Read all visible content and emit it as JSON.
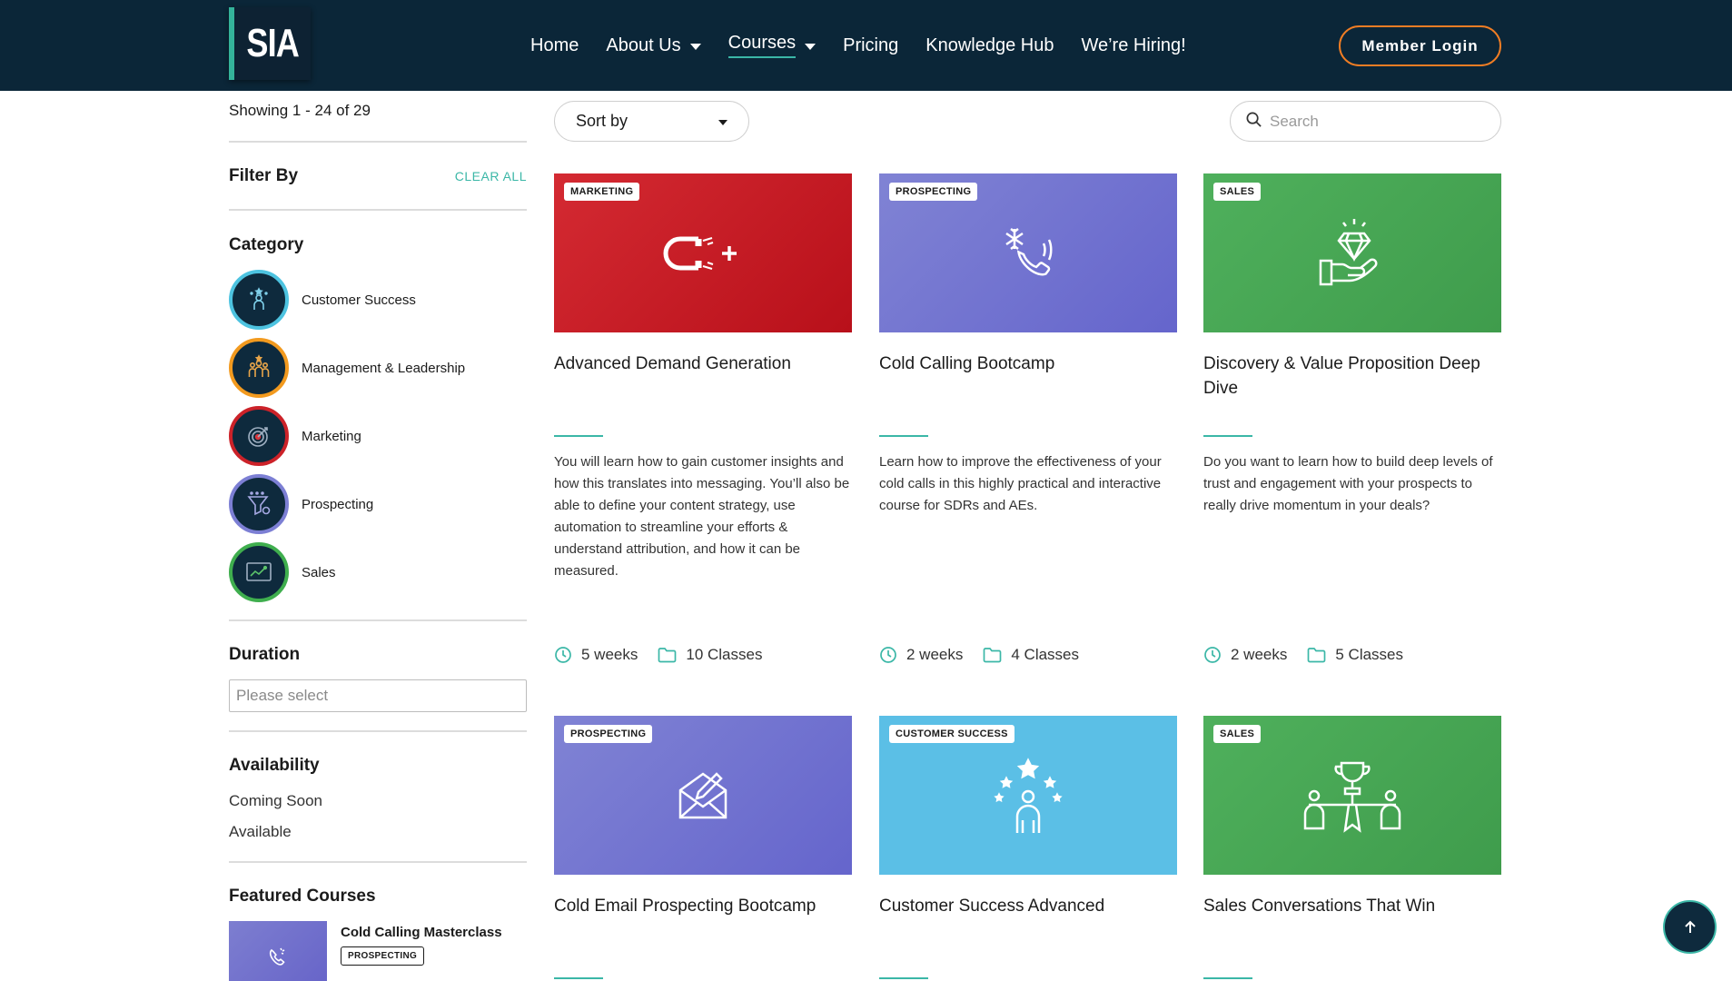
{
  "header": {
    "logo_text": "SIA",
    "nav": [
      {
        "label": "Home"
      },
      {
        "label": "About Us"
      },
      {
        "label": "Courses"
      },
      {
        "label": "Pricing"
      },
      {
        "label": "Knowledge Hub"
      },
      {
        "label": "We’re Hiring!"
      }
    ],
    "login_label": "Member Login"
  },
  "sidebar": {
    "showing": "Showing 1 - 24 of 29",
    "filter_by": "Filter By",
    "clear_all": "CLEAR ALL",
    "category_heading": "Category",
    "categories": [
      {
        "label": "Customer Success",
        "color": "#4dc3e0"
      },
      {
        "label": "Management & Leadership",
        "color": "#f29a1f"
      },
      {
        "label": "Marketing",
        "color": "#cc2229"
      },
      {
        "label": "Prospecting",
        "color": "#7c7fd4"
      },
      {
        "label": "Sales",
        "color": "#3fae4e"
      }
    ],
    "duration_heading": "Duration",
    "duration_placeholder": "Please select",
    "availability_heading": "Availability",
    "availability": [
      "Coming Soon",
      "Available"
    ],
    "featured_heading": "Featured Courses",
    "featured": {
      "title": "Cold Calling Masterclass",
      "badge": "PROSPECTING"
    }
  },
  "toolbar": {
    "sort_label": "Sort by",
    "search_placeholder": "Search"
  },
  "courses": [
    {
      "badge": "MARKETING",
      "title": "Advanced Demand Generation",
      "desc": "You will learn how to gain customer insights and how this translates into messaging. You’ll also be able to define your content strategy, use automation to streamline your efforts & understand attribution, and how it can be measured.",
      "duration": "5 weeks",
      "classes": "10 Classes",
      "icon": "magnet-icon"
    },
    {
      "badge": "PROSPECTING",
      "title": "Cold Calling Bootcamp",
      "desc": "Learn how to improve the effectiveness of your cold calls in this highly practical and interactive course for SDRs and AEs.",
      "duration": "2 weeks",
      "classes": "4 Classes",
      "icon": "cold-phone-icon"
    },
    {
      "badge": "SALES",
      "title": "Discovery & Value Proposition Deep Dive",
      "desc": "Do you want to learn how to build deep levels of trust and engagement with your prospects to really drive momentum in your deals?",
      "duration": "2 weeks",
      "classes": "5 Classes",
      "icon": "diamond-hand-icon"
    },
    {
      "badge": "PROSPECTING",
      "title": "Cold Email Prospecting Bootcamp",
      "icon": "email-icon"
    },
    {
      "badge": "CUSTOMER SUCCESS",
      "title": "Customer Success Advanced",
      "icon": "star-person-icon"
    },
    {
      "badge": "SALES",
      "title": "Sales Conversations That Win",
      "icon": "trophy-people-icon"
    }
  ],
  "colors": {
    "header_bg": "#0b2638",
    "accent_teal": "#3bb7a7",
    "login_border": "#f07d24",
    "marketing": "#c8102e",
    "prospecting": "#7476d0",
    "sales": "#43a250",
    "customer_success": "#5bbfe6"
  }
}
